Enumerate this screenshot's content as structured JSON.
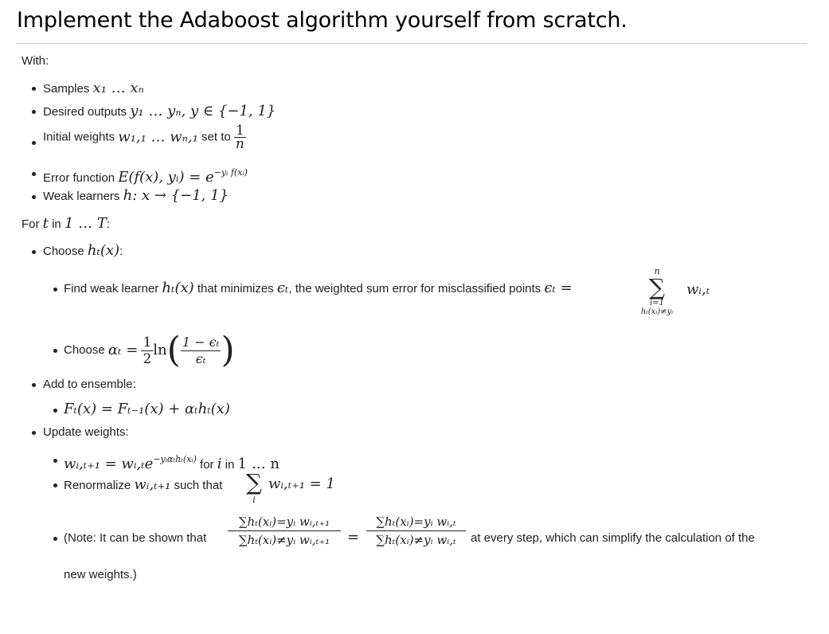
{
  "title": "Implement the Adaboost algorithm yourself from scratch.",
  "with_label": "With:",
  "with_items": {
    "samples_label": "Samples",
    "samples_math": "x₁ … xₙ",
    "outputs_label": "Desired outputs",
    "outputs_math": "y₁ … yₙ, y ∈ {−1, 1}",
    "weights_label": "Initial weights",
    "weights_math": "w₁,₁ … wₙ,₁",
    "weights_set_to": "set to",
    "weights_frac_num": "1",
    "weights_frac_den": "n",
    "error_label": "Error function",
    "error_math": "E(f(x), yᵢ) = e",
    "error_exp": "−yᵢ f(xᵢ)",
    "weak_label": "Weak learners",
    "weak_math": "h: x → {−1, 1}"
  },
  "for_line": {
    "for": "For",
    "t": "t",
    "in": "in",
    "range": "1 … T",
    "colon": ":"
  },
  "choose_h": {
    "label": "Choose",
    "math": "hₜ(x)",
    "colon": ":",
    "find_label": "Find weak learner",
    "find_math": "hₜ(x)",
    "find_text": "that minimizes",
    "eps": "ϵₜ",
    "find_text2": ", the weighted sum error for misclassified points",
    "eps_eq": "ϵₜ =",
    "sum_top": "n",
    "sum_bottom1": "i=1",
    "sum_bottom2": "hₜ(xᵢ)≠yᵢ",
    "sum_term": "wᵢ,ₜ",
    "choose_alpha_label": "Choose",
    "alpha_lhs": "αₜ =",
    "alpha_half_num": "1",
    "alpha_half_den": "2",
    "alpha_ln": "ln",
    "alpha_frac_num": "1 − ϵₜ",
    "alpha_frac_den": "ϵₜ"
  },
  "ensemble": {
    "label": "Add to ensemble:",
    "math": "Fₜ(x) = Fₜ₋₁(x) + αₜhₜ(x)"
  },
  "update": {
    "label": "Update weights:",
    "w_lhs": "wᵢ,ₜ₊₁ = wᵢ,ₜe",
    "w_exp": "−yᵢαₜhₜ(xᵢ)",
    "for": "for",
    "i": "i",
    "in": "in",
    "range": "1 … n",
    "renorm_label": "Renormalize",
    "renorm_math": "wᵢ,ₜ₊₁",
    "renorm_text": "such that",
    "renorm_sum_term": "wᵢ,ₜ₊₁ = 1",
    "renorm_sum_sub": "i",
    "note_text1": "(Note: It can be shown that",
    "note_f1_num": "∑hₜ(xᵢ)=yᵢ wᵢ,ₜ₊₁",
    "note_f1_den": "∑hₜ(xᵢ)≠yᵢ wᵢ,ₜ₊₁",
    "note_eq": "=",
    "note_f2_num": "∑hₜ(xᵢ)=yᵢ wᵢ,ₜ",
    "note_f2_den": "∑hₜ(xᵢ)≠yᵢ wᵢ,ₜ",
    "note_text2": "at every step, which can simplify the calculation of the",
    "note_text3": "new weights.)"
  }
}
